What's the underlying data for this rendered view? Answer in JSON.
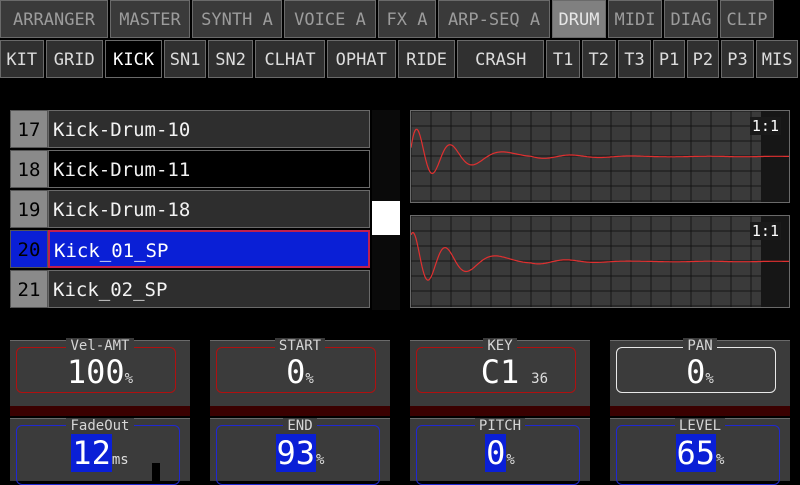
{
  "tabs_top": [
    {
      "label": "ARRANGER",
      "active": false
    },
    {
      "label": "MASTER",
      "active": false
    },
    {
      "label": "SYNTH A",
      "active": false
    },
    {
      "label": "VOICE A",
      "active": false
    },
    {
      "label": "FX A",
      "active": false
    },
    {
      "label": "ARP-SEQ A",
      "active": false
    },
    {
      "label": "DRUM",
      "active": true
    },
    {
      "label": "MIDI",
      "active": false
    },
    {
      "label": "DIAG",
      "active": false
    },
    {
      "label": "CLIP",
      "active": false
    }
  ],
  "tabs_sub": [
    {
      "label": "KIT",
      "active": false
    },
    {
      "label": "GRID",
      "active": false
    },
    {
      "label": "KICK",
      "active": true
    },
    {
      "label": "SN1",
      "active": false
    },
    {
      "label": "SN2",
      "active": false
    },
    {
      "label": "CLHAT",
      "active": false
    },
    {
      "label": "OPHAT",
      "active": false
    },
    {
      "label": "RIDE",
      "active": false
    },
    {
      "label": "CRASH",
      "active": false
    },
    {
      "label": "T1",
      "active": false
    },
    {
      "label": "T2",
      "active": false
    },
    {
      "label": "T3",
      "active": false
    },
    {
      "label": "P1",
      "active": false
    },
    {
      "label": "P2",
      "active": false
    },
    {
      "label": "P3",
      "active": false
    },
    {
      "label": "MIS",
      "active": false
    }
  ],
  "samples": [
    {
      "num": "17",
      "name": "Kick-Drum-10",
      "state": ""
    },
    {
      "num": "18",
      "name": "Kick-Drum-11",
      "state": "current"
    },
    {
      "num": "19",
      "name": "Kick-Drum-18",
      "state": ""
    },
    {
      "num": "20",
      "name": "Kick_01_SP",
      "state": "selected"
    },
    {
      "num": "21",
      "name": "Kick_02_SP",
      "state": ""
    }
  ],
  "scroll": {
    "position": 0.55
  },
  "waveforms": [
    {
      "zoom": "1:1"
    },
    {
      "zoom": "1:1"
    }
  ],
  "colors": {
    "waveform": "#e03030",
    "selection": "#0a1fd6",
    "panel_border_red": "#b01010",
    "panel_border_blue": "#2028d0"
  },
  "params_top": [
    {
      "label": "Vel-AMT",
      "value": "100",
      "unit": "%",
      "sub": "",
      "border": "red"
    },
    {
      "label": "START",
      "value": "0",
      "unit": "%",
      "sub": "",
      "border": "red"
    },
    {
      "label": "KEY",
      "value": "C1",
      "unit": "",
      "sub": "36",
      "border": "red"
    },
    {
      "label": "PAN",
      "value": "0",
      "unit": "%",
      "sub": "",
      "border": "white"
    }
  ],
  "params_bottom": [
    {
      "label": "FadeOut",
      "value": "12",
      "unit": "ms"
    },
    {
      "label": "END",
      "value": "93",
      "unit": "%"
    },
    {
      "label": "PITCH",
      "value": "0",
      "unit": "%"
    },
    {
      "label": "LEVEL",
      "value": "65",
      "unit": "%"
    }
  ]
}
